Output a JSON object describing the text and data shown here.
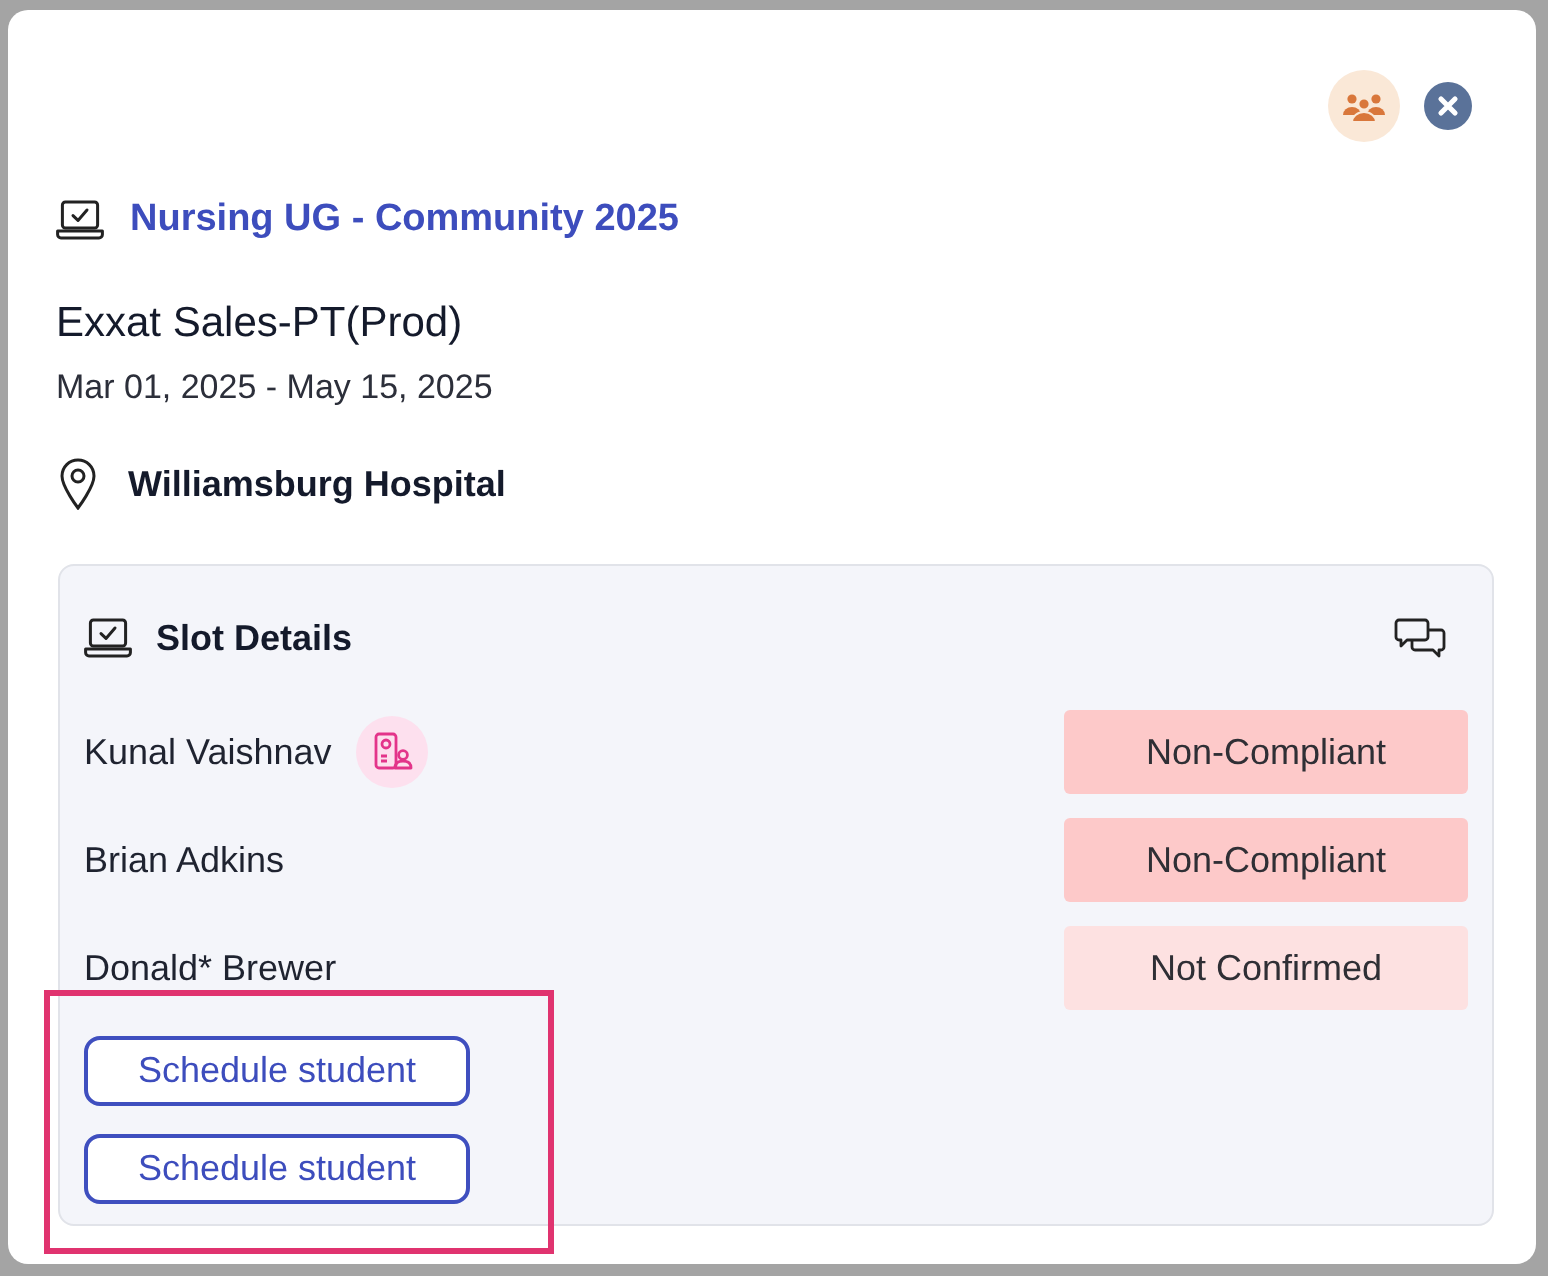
{
  "header": {
    "program": "Nursing UG - Community 2025",
    "title": "Exxat Sales-PT(Prod)",
    "dates": "Mar 01, 2025 - May 15, 2025",
    "location": "Williamsburg Hospital"
  },
  "slot_details": {
    "title": "Slot Details",
    "students": [
      {
        "name": "Kunal Vaishnav",
        "flagged": true,
        "status": "Non-Compliant",
        "color": "#fdc9c9"
      },
      {
        "name": "Brian Adkins",
        "flagged": false,
        "status": "Non-Compliant",
        "color": "#fdc9c9"
      },
      {
        "name": "Donald* Brewer",
        "flagged": false,
        "status": "Not Confirmed",
        "color": "#fde1e1"
      }
    ],
    "actions": {
      "highlighted": true,
      "buttons": [
        "Schedule student",
        "Schedule student"
      ]
    }
  }
}
